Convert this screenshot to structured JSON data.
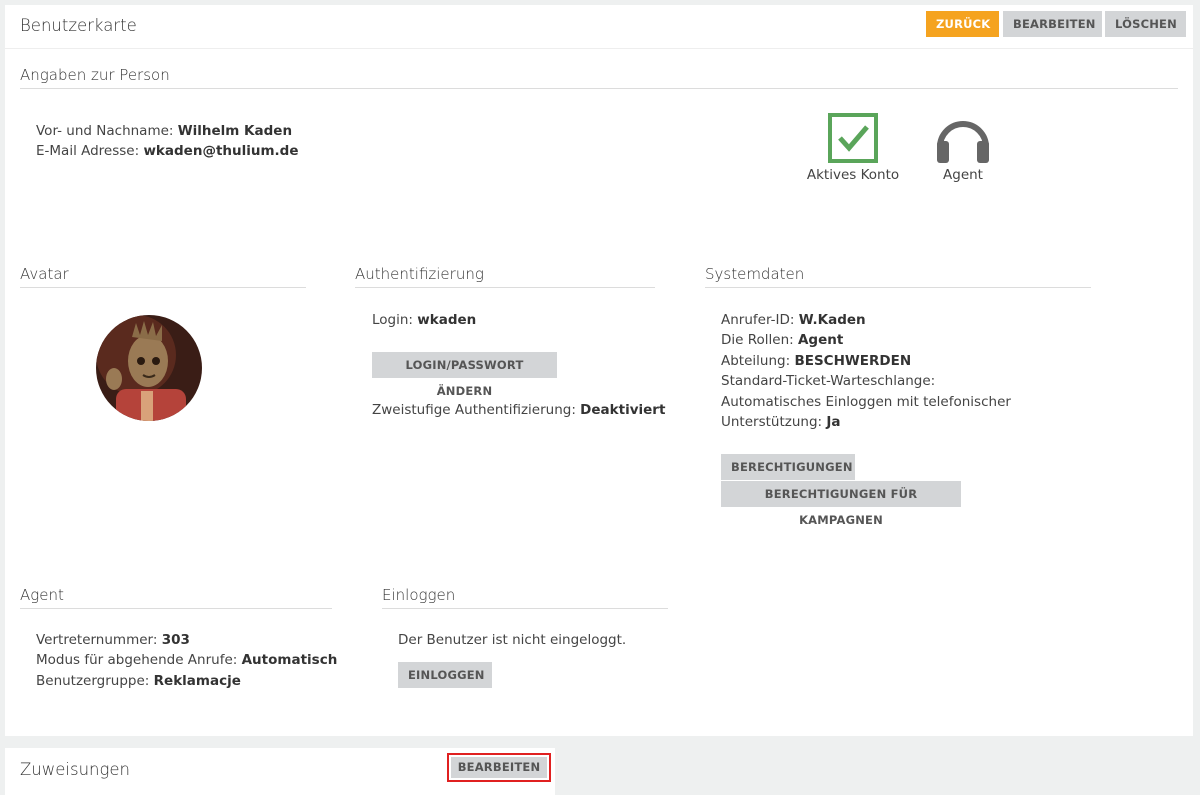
{
  "header": {
    "title": "Benutzerkarte",
    "back_label": "ZURÜCK",
    "edit_label": "BEARBEITEN",
    "delete_label": "LÖSCHEN"
  },
  "person": {
    "title": "Angaben zur Person",
    "name_label": "Vor- und Nachname: ",
    "name_value": "Wilhelm Kaden",
    "email_label": "E-Mail Adresse: ",
    "email_value": "wkaden@thulium.de",
    "active_label": "Aktives Konto",
    "agent_label": "Agent",
    "active_color": "#5aa55a",
    "agent_color": "#666666"
  },
  "avatar": {
    "title": "Avatar"
  },
  "auth": {
    "title": "Authentifizierung",
    "login_label": "Login: ",
    "login_value": "wkaden",
    "change_button": "LOGIN/PASSWORT ÄNDERN",
    "twofactor_label": "Zweistufige Authentifizierung: ",
    "twofactor_value": "Deaktiviert"
  },
  "system": {
    "title": "Systemdaten",
    "caller_label": "Anrufer-ID: ",
    "caller_value": "W.Kaden",
    "roles_label": "Die Rollen: ",
    "roles_value": "Agent",
    "dept_label": "Abteilung: ",
    "dept_value": "BESCHWERDEN",
    "queue_label": "Standard-Ticket-Warteschlange:",
    "autologin_label_1": "Automatisches Einloggen mit telefonischer",
    "autologin_label_2": "Unterstützung: ",
    "autologin_value": "Ja",
    "perm_button": "BERECHTIGUNGEN",
    "perm_campaign_button": "BERECHTIGUNGEN FÜR KAMPAGNEN"
  },
  "agent": {
    "title": "Agent",
    "rep_label": "Vertreternummer: ",
    "rep_value": "303",
    "mode_label": "Modus für abgehende Anrufe: ",
    "mode_value": "Automatisch",
    "group_label": "Benutzergruppe: ",
    "group_value": "Reklamacje"
  },
  "login": {
    "title": "Einloggen",
    "status": "Der Benutzer ist nicht eingeloggt.",
    "button": "EINLOGGEN"
  },
  "assignments": {
    "title": "Zuweisungen",
    "edit_label": "BEARBEITEN",
    "highlight_color": "#e02020"
  },
  "colors": {
    "accent": "#f5a31f",
    "button_gray": "#d3d5d7",
    "background": "#eef0f0"
  }
}
